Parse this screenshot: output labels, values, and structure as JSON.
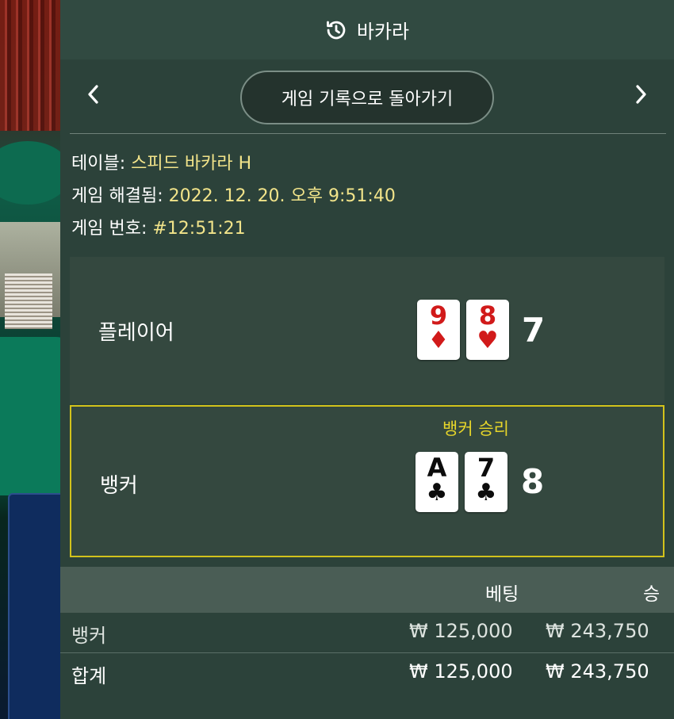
{
  "header": {
    "title": "바카라",
    "icon": "history-icon"
  },
  "nav": {
    "back_label": "게임 기록으로 돌아가기",
    "prev_icon": "chevron-left-icon",
    "next_icon": "chevron-right-icon"
  },
  "info": {
    "table_label": "테이블:",
    "table_value": "스피드 바카라 H",
    "resolved_label": "게임 해결됨:",
    "resolved_value": "2022. 12. 20. 오후 9:51:40",
    "number_label": "게임 번호:",
    "number_value": "#12:51:21"
  },
  "player": {
    "label": "플레이어",
    "score": "7",
    "cards": [
      {
        "rank": "9",
        "suit": "♦",
        "color": "red"
      },
      {
        "rank": "8",
        "suit": "♥",
        "color": "red"
      }
    ]
  },
  "banker": {
    "label": "뱅커",
    "score": "8",
    "win_text": "뱅커 승리",
    "cards": [
      {
        "rank": "A",
        "suit": "♣",
        "color": "black"
      },
      {
        "rank": "7",
        "suit": "♣",
        "color": "black"
      }
    ]
  },
  "table": {
    "col_bet": "베팅",
    "col_win": "승",
    "rows": [
      {
        "name": "뱅커",
        "bet": "₩ 125,000",
        "win": "₩ 243,750"
      },
      {
        "name": "합계",
        "bet": "₩ 125,000",
        "win": "₩ 243,750"
      }
    ]
  },
  "colors": {
    "panel": "#2c423a",
    "accent_yellow": "#d2c21b",
    "value_text": "#f2e48a"
  }
}
